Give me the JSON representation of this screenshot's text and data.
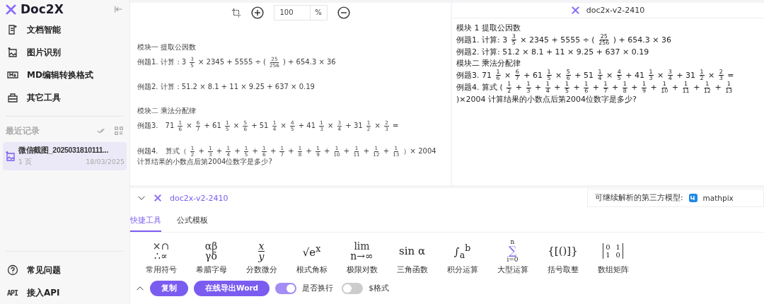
{
  "sidebar": {
    "brand": "Doc2X",
    "nav": [
      {
        "label": "文档智能"
      },
      {
        "label": "图片识别"
      },
      {
        "label": "MD编辑转换格式"
      },
      {
        "label": "其它工具"
      }
    ],
    "recent_title": "最近记录",
    "records": [
      {
        "name": "微信截图_2025031810111...",
        "pages": "1 页",
        "date": "18/03/2025",
        "selected": true
      }
    ],
    "footer": [
      {
        "label": "常见问题"
      },
      {
        "label": "接入API",
        "badge": "API"
      }
    ]
  },
  "viewer": {
    "zoom": "100",
    "zoom_unit": "%",
    "blocks": [
      [
        {
          "parts": [
            {
              "kind": "text",
              "text": "模块一 提取公因数"
            }
          ]
        },
        {
          "parts": [
            {
              "kind": "text",
              "text": "例题1. 计算：3"
            },
            {
              "kind": "frac",
              "num": "3",
              "den": "5"
            },
            {
              "kind": "text",
              "text": "× 2345 + 5555 ÷ ("
            },
            {
              "kind": "frac",
              "num": "25",
              "den": "256"
            },
            {
              "kind": "text",
              "text": ") + 654.3 × 36"
            }
          ]
        }
      ],
      [
        {
          "parts": [
            {
              "kind": "text",
              "text": "例题2. 计算：51.2 × 8.1 + 11 × 9.25 + 637 × 0.19"
            }
          ]
        }
      ],
      [
        {
          "parts": [
            {
              "kind": "text",
              "text": "模块二 乘法分配律"
            }
          ]
        },
        {
          "parts": [
            {
              "kind": "text",
              "text": "例题3.　71"
            },
            {
              "kind": "frac",
              "num": "1",
              "den": "6"
            },
            {
              "kind": "text",
              "text": "×"
            },
            {
              "kind": "frac",
              "num": "6",
              "den": "7"
            },
            {
              "kind": "text",
              "text": "+ 61"
            },
            {
              "kind": "frac",
              "num": "1",
              "den": "5"
            },
            {
              "kind": "text",
              "text": "×"
            },
            {
              "kind": "frac",
              "num": "5",
              "den": "6"
            },
            {
              "kind": "text",
              "text": "+ 51"
            },
            {
              "kind": "frac",
              "num": "1",
              "den": "4"
            },
            {
              "kind": "text",
              "text": "×"
            },
            {
              "kind": "frac",
              "num": "4",
              "den": "5"
            },
            {
              "kind": "text",
              "text": "+ 41"
            },
            {
              "kind": "frac",
              "num": "1",
              "den": "3"
            },
            {
              "kind": "text",
              "text": "×"
            },
            {
              "kind": "frac",
              "num": "3",
              "den": "4"
            },
            {
              "kind": "text",
              "text": "+ 31"
            },
            {
              "kind": "frac",
              "num": "1",
              "den": "2"
            },
            {
              "kind": "text",
              "text": "×"
            },
            {
              "kind": "frac",
              "num": "2",
              "den": "3"
            },
            {
              "kind": "text",
              "text": "="
            }
          ]
        }
      ],
      [
        {
          "parts": [
            {
              "kind": "text",
              "text": "例题4.　算式（"
            },
            {
              "kind": "frac",
              "num": "1",
              "den": "2"
            },
            {
              "kind": "text",
              "text": "+"
            },
            {
              "kind": "frac",
              "num": "1",
              "den": "3"
            },
            {
              "kind": "text",
              "text": "+"
            },
            {
              "kind": "frac",
              "num": "1",
              "den": "4"
            },
            {
              "kind": "text",
              "text": "+"
            },
            {
              "kind": "frac",
              "num": "1",
              "den": "5"
            },
            {
              "kind": "text",
              "text": "+"
            },
            {
              "kind": "frac",
              "num": "1",
              "den": "6"
            },
            {
              "kind": "text",
              "text": "+"
            },
            {
              "kind": "frac",
              "num": "1",
              "den": "7"
            },
            {
              "kind": "text",
              "text": "+"
            },
            {
              "kind": "frac",
              "num": "1",
              "den": "8"
            },
            {
              "kind": "text",
              "text": "+"
            },
            {
              "kind": "frac",
              "num": "1",
              "den": "9"
            },
            {
              "kind": "text",
              "text": "+"
            },
            {
              "kind": "frac",
              "num": "1",
              "den": "10"
            },
            {
              "kind": "text",
              "text": "+"
            },
            {
              "kind": "frac",
              "num": "1",
              "den": "11"
            },
            {
              "kind": "text",
              "text": "+"
            },
            {
              "kind": "frac",
              "num": "1",
              "den": "12"
            },
            {
              "kind": "text",
              "text": "+"
            },
            {
              "kind": "frac",
              "num": "1",
              "den": "13"
            },
            {
              "kind": "text",
              "text": "）× 2004 计算结果的小数点后第2004位数字是多少?"
            }
          ]
        }
      ]
    ]
  },
  "preview": {
    "model": "doc2x-v2-2410",
    "lines": [
      {
        "parts": [
          {
            "kind": "text",
            "text": "模块 1 提取公因数"
          }
        ]
      },
      {
        "parts": [
          {
            "kind": "text",
            "text": "例题1. 计算: 3"
          },
          {
            "kind": "frac",
            "num": "3",
            "den": "5"
          },
          {
            "kind": "text",
            "text": "× 2345 + 5555 ÷ ("
          },
          {
            "kind": "frac",
            "num": "25",
            "den": "256"
          },
          {
            "kind": "text",
            "text": ") + 654.3 × 36"
          }
        ]
      },
      {
        "parts": [
          {
            "kind": "text",
            "text": "例题2. 计算: 51.2 × 8.1 + 11 × 9.25 + 637 × 0.19"
          }
        ]
      },
      {
        "parts": [
          {
            "kind": "text",
            "text": "模块二 乘法分配律"
          }
        ]
      },
      {
        "parts": [
          {
            "kind": "text",
            "text": "例题3. 71"
          },
          {
            "kind": "frac",
            "num": "1",
            "den": "6"
          },
          {
            "kind": "text",
            "text": "×"
          },
          {
            "kind": "frac",
            "num": "6",
            "den": "7"
          },
          {
            "kind": "text",
            "text": "+ 61"
          },
          {
            "kind": "frac",
            "num": "1",
            "den": "5"
          },
          {
            "kind": "text",
            "text": "×"
          },
          {
            "kind": "frac",
            "num": "5",
            "den": "6"
          },
          {
            "kind": "text",
            "text": "+ 51"
          },
          {
            "kind": "frac",
            "num": "1",
            "den": "4"
          },
          {
            "kind": "text",
            "text": "×"
          },
          {
            "kind": "frac",
            "num": "4",
            "den": "5"
          },
          {
            "kind": "text",
            "text": "+ 41"
          },
          {
            "kind": "frac",
            "num": "1",
            "den": "3"
          },
          {
            "kind": "text",
            "text": "×"
          },
          {
            "kind": "frac",
            "num": "3",
            "den": "4"
          },
          {
            "kind": "text",
            "text": "+ 31"
          },
          {
            "kind": "frac",
            "num": "1",
            "den": "2"
          },
          {
            "kind": "text",
            "text": "×"
          },
          {
            "kind": "frac",
            "num": "2",
            "den": "3"
          },
          {
            "kind": "text",
            "text": "="
          }
        ]
      },
      {
        "parts": [
          {
            "kind": "text",
            "text": "例题4. 算式 ("
          },
          {
            "kind": "frac",
            "num": "1",
            "den": "2"
          },
          {
            "kind": "text",
            "text": "+"
          },
          {
            "kind": "frac",
            "num": "1",
            "den": "3"
          },
          {
            "kind": "text",
            "text": "+"
          },
          {
            "kind": "frac",
            "num": "1",
            "den": "4"
          },
          {
            "kind": "text",
            "text": "+"
          },
          {
            "kind": "frac",
            "num": "1",
            "den": "5"
          },
          {
            "kind": "text",
            "text": "+"
          },
          {
            "kind": "frac",
            "num": "1",
            "den": "6"
          },
          {
            "kind": "text",
            "text": "+"
          },
          {
            "kind": "frac",
            "num": "1",
            "den": "7"
          },
          {
            "kind": "text",
            "text": "+"
          },
          {
            "kind": "frac",
            "num": "1",
            "den": "8"
          },
          {
            "kind": "text",
            "text": "+"
          },
          {
            "kind": "frac",
            "num": "1",
            "den": "9"
          },
          {
            "kind": "text",
            "text": "+"
          },
          {
            "kind": "frac",
            "num": "1",
            "den": "10"
          },
          {
            "kind": "text",
            "text": "+"
          },
          {
            "kind": "frac",
            "num": "1",
            "den": "11"
          },
          {
            "kind": "text",
            "text": "+"
          },
          {
            "kind": "frac",
            "num": "1",
            "den": "12"
          },
          {
            "kind": "text",
            "text": "+"
          },
          {
            "kind": "frac",
            "num": "1",
            "den": "13"
          },
          {
            "kind": "text",
            "text": ")×2004 计算结果的小数点后第2004位数字是多少?"
          }
        ]
      }
    ]
  },
  "editor": {
    "model": "doc2x-v2-2410",
    "third_party_label": "可继续解析的第三方模型:",
    "third_party_model": "mathpix",
    "tabs": [
      {
        "label": "快捷工具",
        "selected": true
      },
      {
        "label": "公式模板",
        "selected": false
      }
    ],
    "tools": [
      {
        "label": "常用符号",
        "kind": "stack",
        "lines": [
          "×∩",
          "∴∝"
        ]
      },
      {
        "label": "希腊字母",
        "kind": "stack",
        "lines": [
          "αβ",
          "γδ"
        ]
      },
      {
        "label": "分数微分",
        "kind": "fraction",
        "lines": [
          "x",
          "y"
        ]
      },
      {
        "label": "根式角标",
        "kind": "inline",
        "text": "√e$^{x}$"
      },
      {
        "label": "极限对数",
        "kind": "stack",
        "lines": [
          "lim",
          "n→∞"
        ]
      },
      {
        "label": "三角函数",
        "kind": "inline",
        "text": "sin α"
      },
      {
        "label": "积分运算",
        "kind": "inline",
        "text": "∫$_{a}$$^{b}$"
      },
      {
        "label": "大型运算",
        "kind": "stack",
        "lines": [
          "n",
          "∑",
          "i=0"
        ]
      },
      {
        "label": "括号取整",
        "kind": "inline",
        "text": "{[()]}"
      },
      {
        "label": "数组矩阵",
        "kind": "matrix",
        "rows": [
          [
            "0",
            "1"
          ],
          [
            "1",
            "0"
          ]
        ]
      }
    ],
    "buttons": [
      "复制",
      "在线导出Word"
    ],
    "toggles": [
      {
        "label": "是否换行",
        "on": true
      },
      {
        "label": "$格式",
        "on": false
      }
    ]
  }
}
